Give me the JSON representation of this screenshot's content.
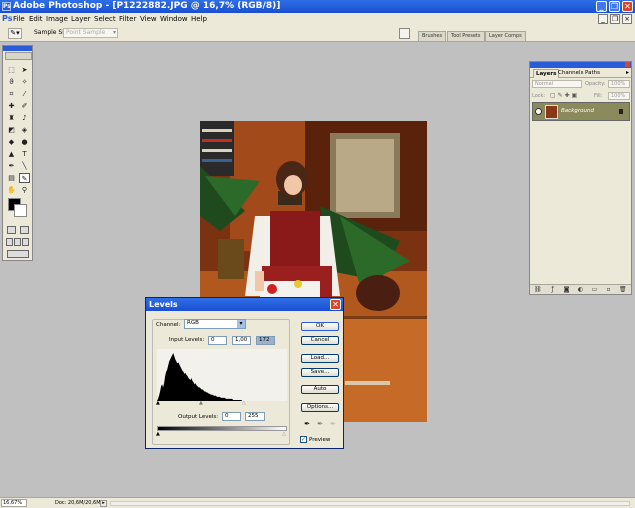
{
  "window": {
    "title": "Adobe Photoshop - [P1222882.JPG @ 16,7% (RGB/8)]",
    "ps_glyph": "Ps"
  },
  "menu": [
    "File",
    "Edit",
    "Image",
    "Layer",
    "Select",
    "Filter",
    "View",
    "Window",
    "Help"
  ],
  "options_bar": {
    "sample_size_label": "Sample Size:",
    "sample_size_value": "Point Sample"
  },
  "palette_well_tabs": [
    "Brushes",
    "Tool Presets",
    "Layer Comps"
  ],
  "layers_panel": {
    "tabs": [
      "Layers",
      "Channels",
      "Paths"
    ],
    "blend_mode": "Normal",
    "opacity_label": "Opacity:",
    "opacity_value": "100%",
    "lock_label": "Lock:",
    "fill_label": "Fill:",
    "fill_value": "100%",
    "layer_name": "Background"
  },
  "levels_dialog": {
    "title": "Levels",
    "channel_label": "Channel:",
    "channel_value": "RGB",
    "input_levels_label": "Input Levels:",
    "input_black": "0",
    "input_gamma": "1,00",
    "input_white": "172",
    "output_levels_label": "Output Levels:",
    "output_black": "0",
    "output_white": "255",
    "buttons": {
      "ok": "OK",
      "cancel": "Cancel",
      "load": "Load...",
      "save": "Save...",
      "auto": "Auto",
      "options": "Options..."
    },
    "preview_label": "Preview",
    "preview_checked": true,
    "histogram_bins": [
      0,
      2,
      5,
      9,
      14,
      16,
      13,
      17,
      24,
      28,
      30,
      34,
      38,
      40,
      42,
      44,
      46,
      43,
      40,
      38,
      36,
      37,
      35,
      33,
      31,
      29,
      28,
      26,
      27,
      25,
      24,
      22,
      21,
      20,
      22,
      19,
      18,
      16,
      17,
      15,
      14,
      13,
      13,
      12,
      11,
      11,
      10,
      9,
      9,
      8,
      8,
      7,
      7,
      6,
      6,
      6,
      5,
      5,
      5,
      4,
      4,
      4,
      4,
      3,
      3,
      3,
      3,
      3,
      2,
      2,
      2,
      2,
      2,
      2,
      2,
      1,
      1,
      1,
      1,
      1,
      1,
      1,
      1,
      1,
      0,
      0,
      0,
      0,
      0,
      0,
      0,
      0,
      0,
      0,
      0,
      0,
      0,
      0,
      0,
      0,
      0,
      0,
      0,
      0,
      0,
      0,
      0,
      0,
      0,
      0,
      0,
      0,
      0,
      0,
      0,
      0,
      0,
      0,
      0,
      0,
      0,
      0,
      0,
      0,
      0,
      0,
      0,
      0
    ]
  },
  "status_bar": {
    "zoom": "16,67%",
    "doc": "Doc: 20,6M/20,6M",
    "arrow": "▸"
  },
  "colors": {
    "title_blue": "#1a4fcf",
    "chrome": "#ece9d8",
    "workspace": "#c0c0c0",
    "close_red": "#d8452b",
    "layer_selected": "#8a8a5c"
  }
}
